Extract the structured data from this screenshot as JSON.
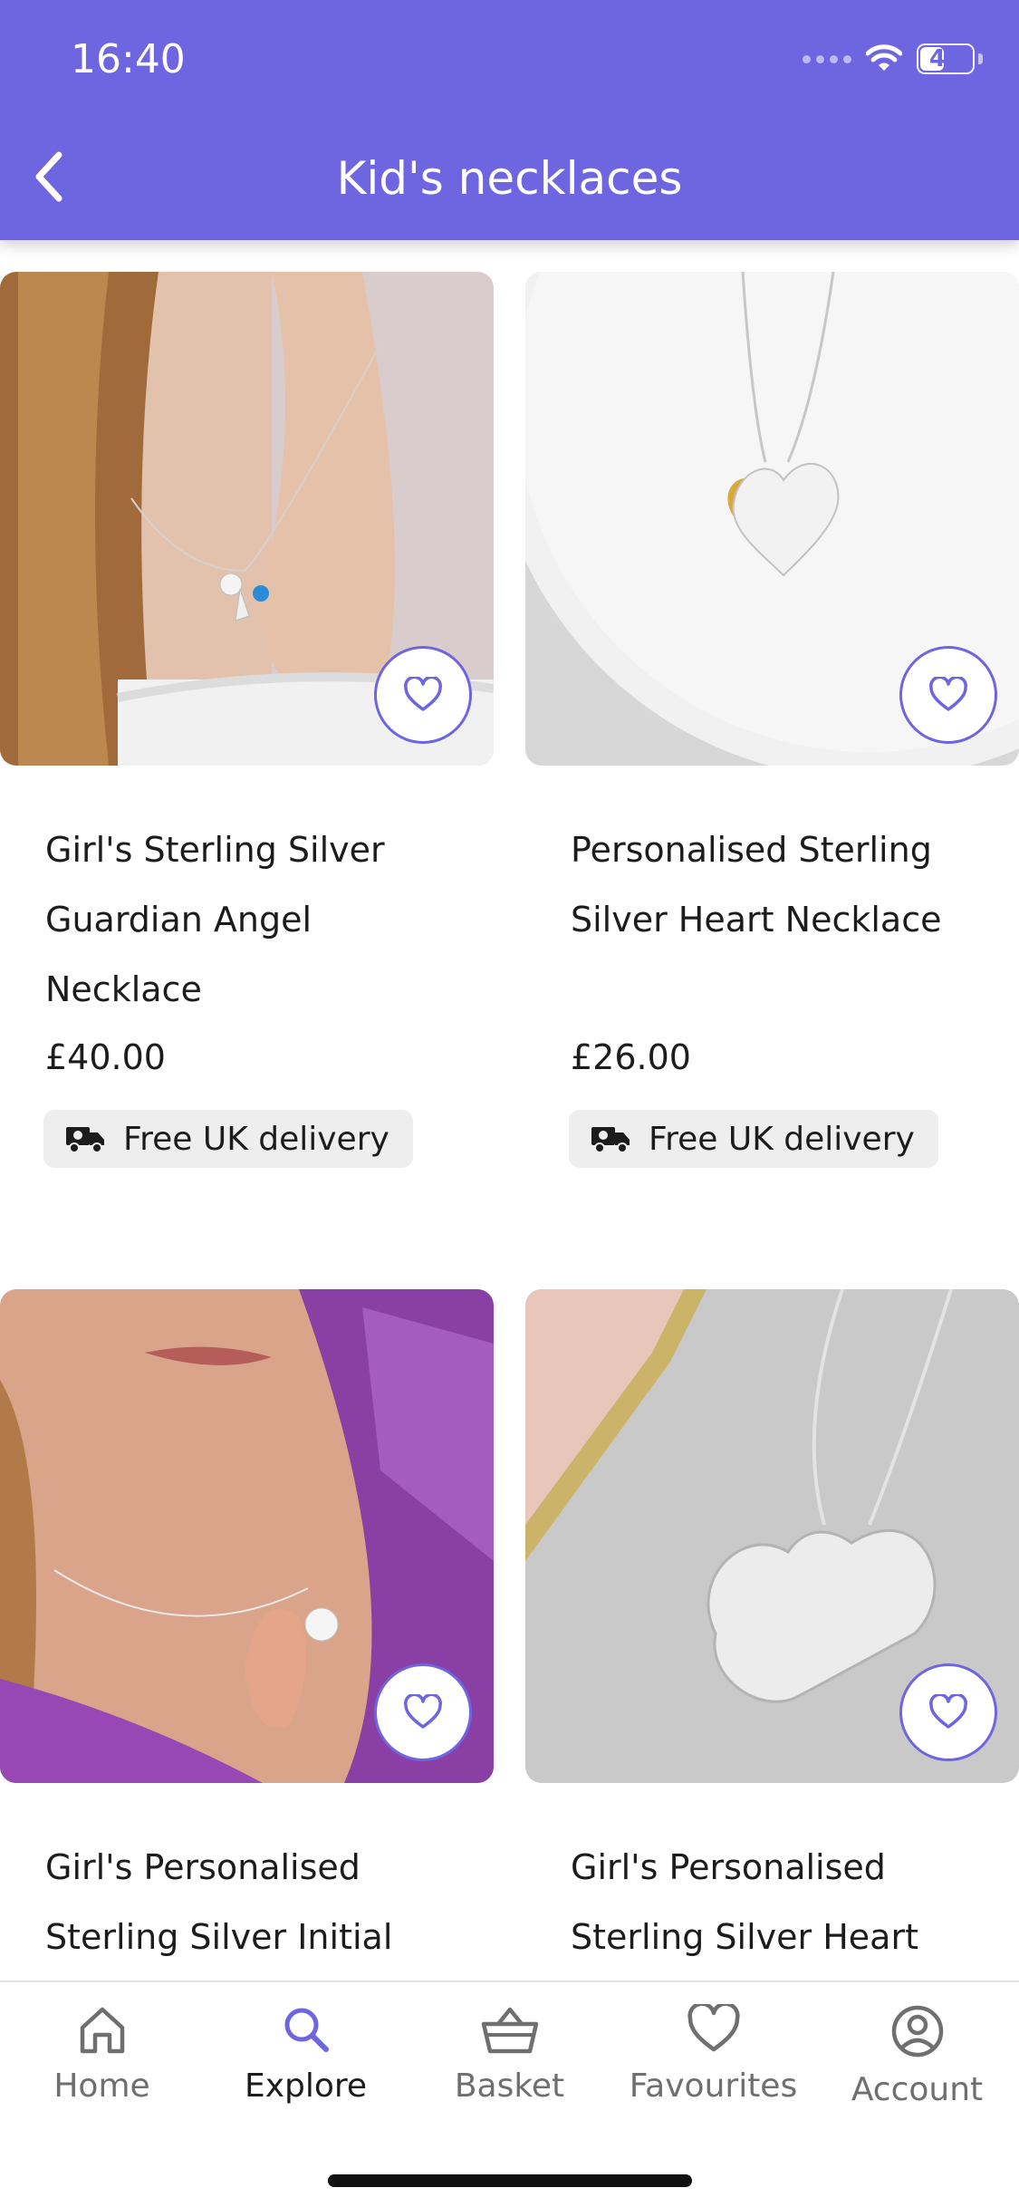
{
  "status_bar": {
    "time": "16:40",
    "battery": "47",
    "battery_level": 0.47
  },
  "header": {
    "title": "Kid's necklaces",
    "back_icon": "chevron-left-icon",
    "background": "#6e65e0"
  },
  "products": [
    {
      "title": "Girl's Sterling Silver Guardian Angel Necklace",
      "price": "£40.00",
      "delivery": "Free UK delivery",
      "favourite_icon": "heart-outline-icon"
    },
    {
      "title": "Personalised Sterling Silver Heart Necklace",
      "price": "£26.00",
      "delivery": "Free UK delivery",
      "favourite_icon": "heart-outline-icon"
    },
    {
      "title": "Girl's Personalised Sterling Silver Initial",
      "favourite_icon": "heart-outline-icon"
    },
    {
      "title": "Girl's Personalised Sterling Silver Heart",
      "favourite_icon": "heart-outline-icon"
    }
  ],
  "tabbar": {
    "items": [
      {
        "label": "Home",
        "icon": "home-icon",
        "active": false
      },
      {
        "label": "Explore",
        "icon": "search-icon",
        "active": true
      },
      {
        "label": "Basket",
        "icon": "basket-icon",
        "active": false
      },
      {
        "label": "Favourites",
        "icon": "heart-icon",
        "active": false
      },
      {
        "label": "Account",
        "icon": "account-icon",
        "active": false
      }
    ],
    "accent": "#6e65e0"
  }
}
